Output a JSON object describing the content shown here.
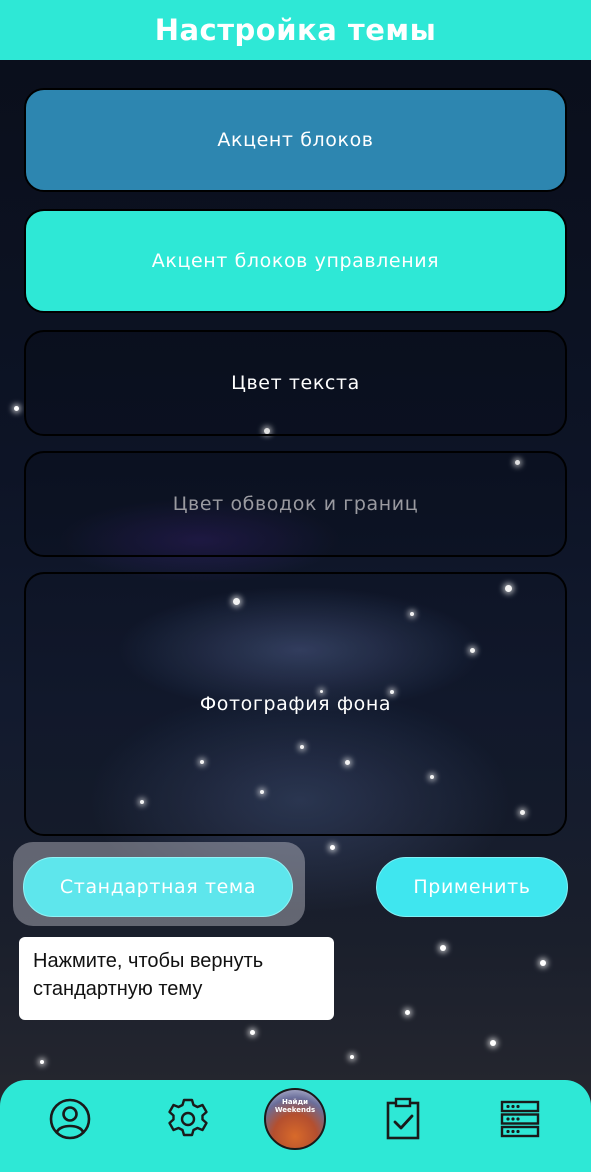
{
  "header": {
    "title": "Настройка темы"
  },
  "blocks": [
    {
      "label": "Акцент блоков"
    },
    {
      "label": "Акцент блоков управления"
    },
    {
      "label": "Цвет текста"
    },
    {
      "label": "Цвет обводок и границ"
    },
    {
      "label": "Фотография фона"
    }
  ],
  "actions": {
    "default_theme_label": "Стандартная тема",
    "apply_label": "Применить"
  },
  "tooltip": {
    "text": "Нажмите, чтобы вернуть стандартную тему"
  },
  "navbar": {
    "items": [
      "profile-icon",
      "settings-gear-icon",
      "app-avatar",
      "clipboard-check-icon",
      "server-list-icon"
    ],
    "avatar_text": "Найди Weekends"
  },
  "colors": {
    "accent": "#2ee8d6",
    "block_accent": "#2d86b0",
    "button": "#5ee6ec",
    "border_text": "#9a9aa0"
  }
}
